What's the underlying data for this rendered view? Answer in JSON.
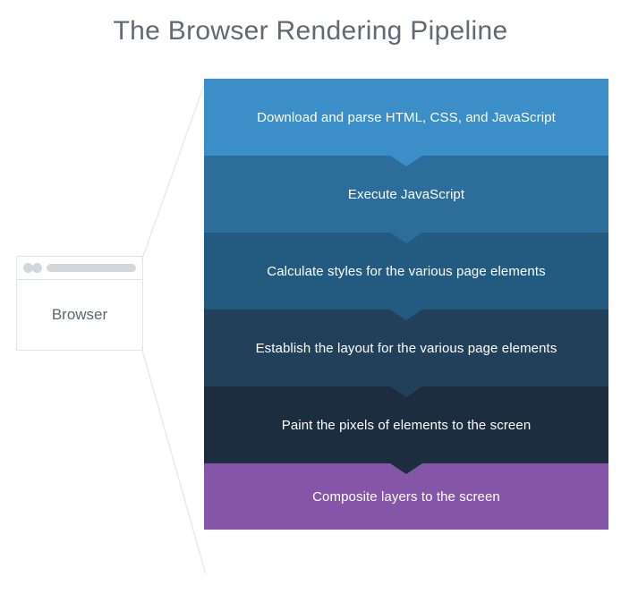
{
  "title": "The Browser Rendering Pipeline",
  "browser": {
    "label": "Browser"
  },
  "steps": [
    {
      "label": "Download and parse HTML, CSS, and JavaScript",
      "color": "#3c8ec9"
    },
    {
      "label": "Execute JavaScript",
      "color": "#2c6d9c"
    },
    {
      "label": "Calculate styles for the various page elements",
      "color": "#235a80"
    },
    {
      "label": "Establish the layout for the various page elements",
      "color": "#23405b"
    },
    {
      "label": "Paint the pixels of elements to the screen",
      "color": "#1c2d40"
    },
    {
      "label": "Composite layers to the screen",
      "color": "#8556a8"
    }
  ]
}
